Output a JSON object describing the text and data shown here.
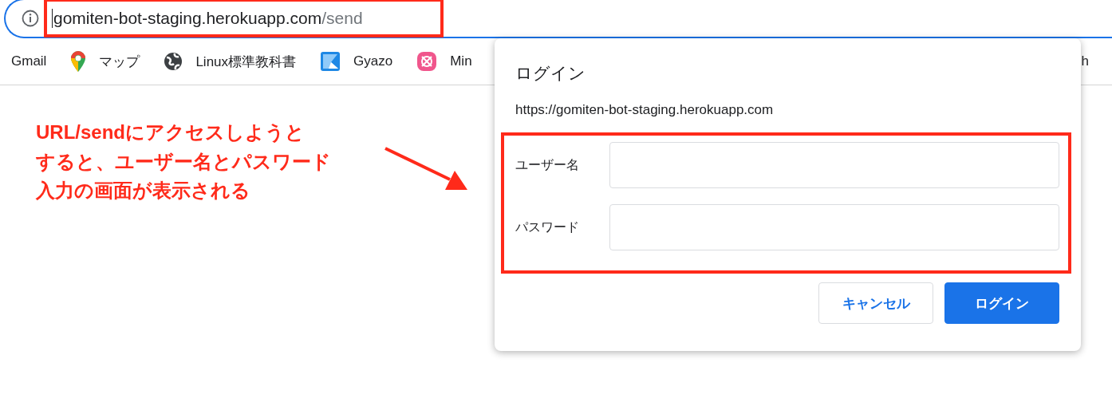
{
  "address_bar": {
    "host": "gomiten-bot-staging.herokuapp.com",
    "path": "/send",
    "highlighted": true
  },
  "bookmarks": [
    {
      "label": "Gmail",
      "kind": "none"
    },
    {
      "label": "マップ",
      "kind": "pin"
    },
    {
      "label": "Linux標準教科書",
      "kind": "globe"
    },
    {
      "label": "Gyazo",
      "kind": "gyazo"
    },
    {
      "label": "Min",
      "kind": "app"
    }
  ],
  "bookmark_tail": "h",
  "annotation": {
    "lines": [
      "URL/sendにアクセスしようと",
      "すると、ユーザー名とパスワード",
      "入力の画面が表示される"
    ]
  },
  "dialog": {
    "title": "ログイン",
    "origin": "https://gomiten-bot-staging.herokuapp.com",
    "fields": [
      {
        "label": "ユーザー名"
      },
      {
        "label": "パスワード"
      }
    ],
    "fields_highlighted": true,
    "buttons": [
      {
        "label": "キャンセル",
        "kind": "secondary"
      },
      {
        "label": "ログイン",
        "kind": "primary"
      }
    ]
  }
}
